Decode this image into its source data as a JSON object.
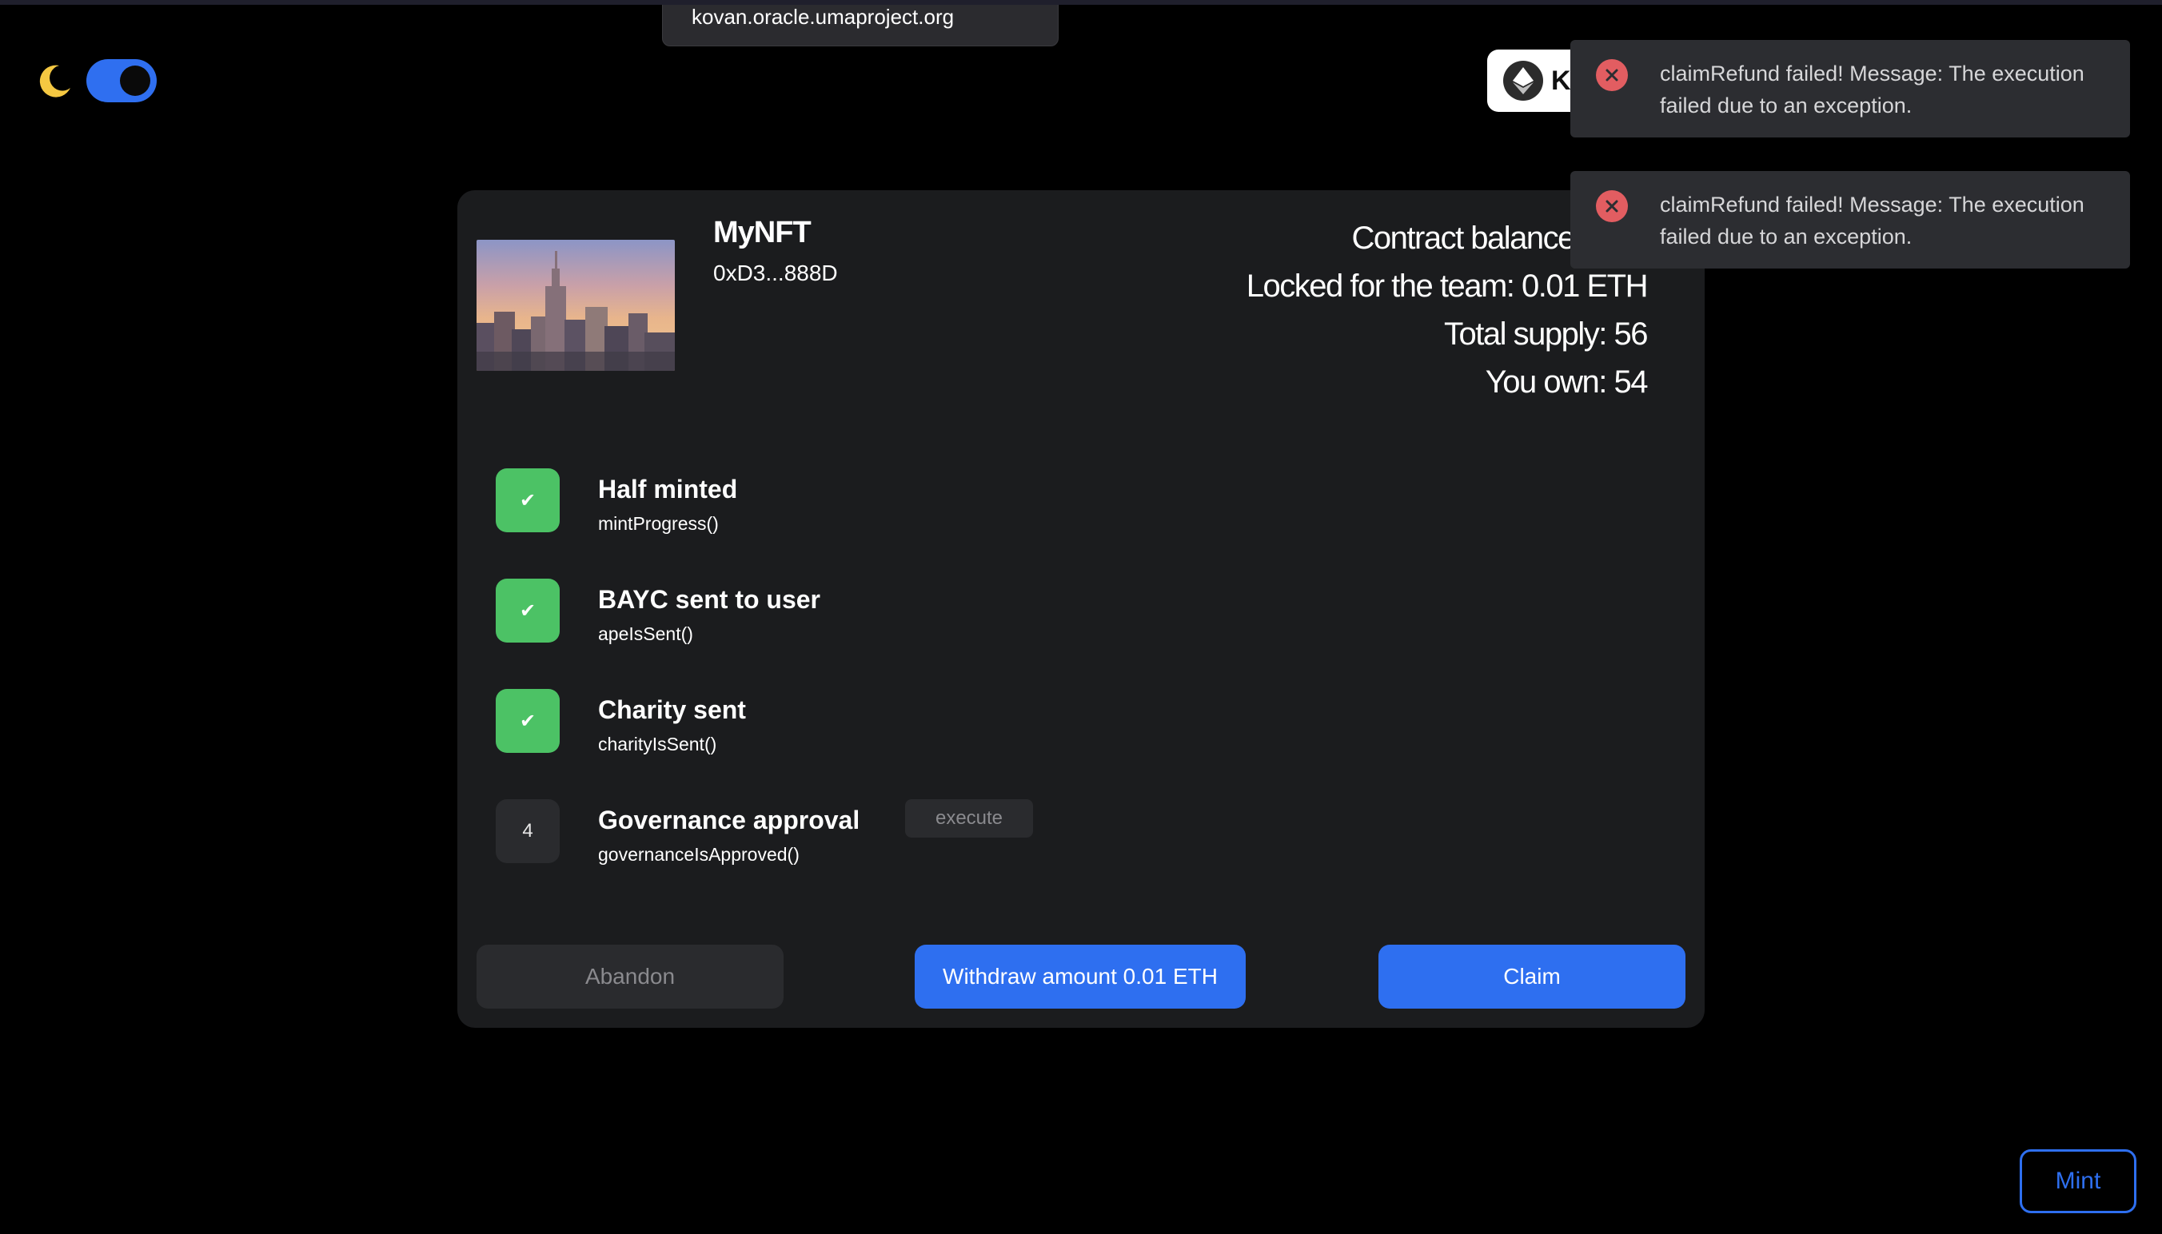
{
  "browser": {
    "url": "kovan.oracle.umaproject.org"
  },
  "theme": {
    "mode_icon": "moon-icon",
    "toggle_on": true,
    "toggle_color": "#2f6ff0"
  },
  "network": {
    "icon": "ethereum-icon",
    "label": "K"
  },
  "nft": {
    "name": "MyNFT",
    "address": "0xD3...888D",
    "thumbnail": "city-skyline-image"
  },
  "stats": {
    "contract_balance": "Contract balance: 0.04",
    "locked": "Locked for the team: 0.01 ETH",
    "total_supply": "Total supply: 56",
    "you_own": "You own: 54"
  },
  "steps": [
    {
      "badge": "✔",
      "status": "done",
      "title": "Half minted",
      "fn": "mintProgress()"
    },
    {
      "badge": "✔",
      "status": "done",
      "title": "BAYC sent to user",
      "fn": "apeIsSent()"
    },
    {
      "badge": "✔",
      "status": "done",
      "title": "Charity sent",
      "fn": "charityIsSent()"
    },
    {
      "badge": "4",
      "status": "pending",
      "title": "Governance approval",
      "fn": "governanceIsApproved()",
      "action": "execute"
    }
  ],
  "actions": {
    "abandon": "Abandon",
    "withdraw": "Withdraw amount 0.01 ETH",
    "claim": "Claim",
    "mint": "Mint"
  },
  "toasts": [
    {
      "icon": "error-icon",
      "message": "claimRefund failed! Message: The execution failed due to an exception."
    },
    {
      "icon": "error-icon",
      "message": "claimRefund failed! Message: The execution failed due to an exception."
    }
  ],
  "colors": {
    "accent": "#2e6ff0",
    "success": "#4cc265",
    "error": "#e25d61",
    "card": "#1b1c1e"
  }
}
